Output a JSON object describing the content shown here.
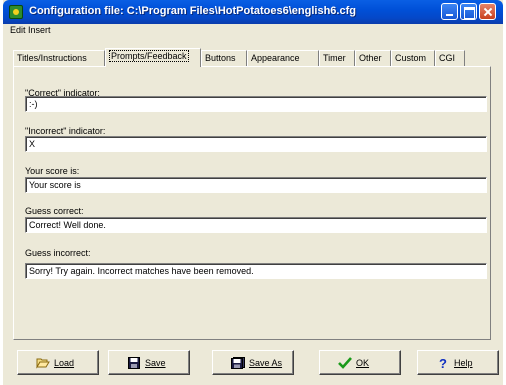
{
  "window": {
    "title": "Configuration file: C:\\Program Files\\HotPotatoes6\\english6.cfg"
  },
  "menu": {
    "items": [
      "Edit",
      "Insert"
    ]
  },
  "tabs": [
    {
      "label": "Titles/Instructions"
    },
    {
      "label": "Prompts/Feedback"
    },
    {
      "label": "Buttons"
    },
    {
      "label": "Appearance"
    },
    {
      "label": "Timer"
    },
    {
      "label": "Other"
    },
    {
      "label": "Custom"
    },
    {
      "label": "CGI"
    }
  ],
  "active_tab": "Prompts/Feedback",
  "fields": [
    {
      "label": "\"Correct\" indicator:",
      "value": ":-)"
    },
    {
      "label": "\"Incorrect\" indicator:",
      "value": "X"
    },
    {
      "label": "Your score is:",
      "value": "Your score is"
    },
    {
      "label": "Guess correct:",
      "value": "Correct! Well done."
    },
    {
      "label": "Guess incorrect:",
      "value": "Sorry! Try again. Incorrect matches have been removed."
    }
  ],
  "buttons": {
    "load": "Load",
    "save": "Save",
    "save_as": "Save As",
    "ok": "OK",
    "help": "Help"
  },
  "icons": {
    "load": "folder-open-icon",
    "save": "floppy-disk-icon",
    "save_as": "floppy-disk-stack-icon",
    "ok": "checkmark-icon",
    "help": "question-mark-icon"
  },
  "colors": {
    "title_bar": "#0050d8",
    "window_face": "#ece9d8",
    "ok_check": "#1a9a1a",
    "help_mark": "#1030c0"
  }
}
